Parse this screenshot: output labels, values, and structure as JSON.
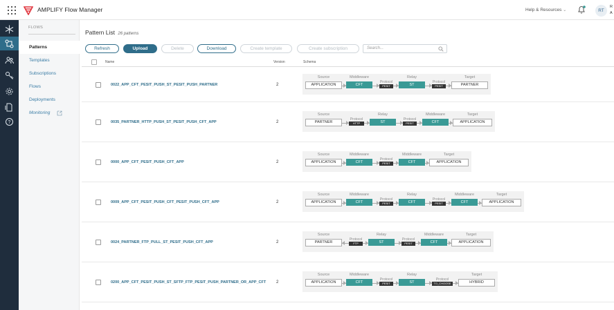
{
  "header": {
    "app_title": "AMPLIFY Flow Manager",
    "help_label": "Help & Resources",
    "avatar_initials": "RT",
    "user_initial_top": "R",
    "user_initial_bottom": "A",
    "brand_color": "#e0343c"
  },
  "rail": {
    "icons": [
      "snowflake-icon",
      "patterns-icon",
      "people-icon",
      "key-icon",
      "gear-icon",
      "document-icon",
      "help-icon"
    ],
    "active_color": "#2f6d8a"
  },
  "subnav": {
    "section": "FLOWS",
    "items": [
      {
        "label": "Patterns",
        "selected": true
      },
      {
        "label": "Templates"
      },
      {
        "label": "Subscriptions"
      },
      {
        "label": "Flows"
      },
      {
        "label": "Deployments"
      },
      {
        "label": "Monitoring"
      }
    ]
  },
  "page": {
    "title": "Pattern List",
    "count": "26 patterns"
  },
  "toolbar": {
    "refresh": "Refresh",
    "upload": "Upload",
    "delete": "Delete",
    "download": "Download",
    "create_template": "Create template",
    "create_subscription": "Create subscription",
    "search_placeholder": "Search..."
  },
  "table": {
    "columns": [
      "Name",
      "Version",
      "Schema"
    ],
    "rows": [
      {
        "name": "0022_APP_CFT_PESIT_PUSH_ST_PESIT_PUSH_PARTNER",
        "version": "2",
        "schema": {
          "source": {
            "label": "Source",
            "value": "APPLICATION"
          },
          "links": [
            {
              "proto_label": "Protocol",
              "proto": "PESIT",
              "node_label": "Middleware",
              "node": "CFT",
              "pre_label": "Middleware",
              "pre": "CFT"
            }
          ]
        }
      }
    ],
    "schemas": [
      {
        "name": "0022_APP_CFT_PESIT_PUSH_ST_PESIT_PUSH_PARTNER",
        "version": "2",
        "source": "APPLICATION",
        "middleware": "CFT",
        "protocol_1": "PESIT",
        "relay": "ST",
        "protocol_2": "PESIT",
        "target": "PARTNER"
      },
      {
        "name": "0035_PARTNER_HTTP_PUSH_ST_PESIT_PUSH_CFT_APP",
        "version": "2",
        "source": "PARTNER",
        "protocol_1": "HTTP",
        "relay": "ST",
        "protocol_2": "PESIT",
        "middleware": "CFT",
        "target": "APPLICATION"
      },
      {
        "name": "0000_APP_CFT_PESIT_PUSH_CFT_APP",
        "version": "2",
        "source": "APPLICATION",
        "middleware": "CFT",
        "protocol_1": "PESIT",
        "middleware_2": "CFT",
        "target": "APPLICATION"
      },
      {
        "name": "0009_APP_CFT_PESIT_PUSH_CFT_PESIT_PUSH_CFT_APP",
        "version": "2",
        "source": "APPLICATION",
        "middleware": "CFT",
        "protocol_1": "PESIT",
        "relay": "CFT",
        "protocol_2": "PESIT",
        "middleware_2": "CFT",
        "target": "APPLICATION"
      },
      {
        "name": "0024_PARTNER_FTP_PULL_ST_PESIT_PUSH_CFT_APP",
        "version": "2",
        "source": "PARTNER",
        "protocol_1": "FTP",
        "relay": "ST",
        "protocol_2": "PESIT",
        "middleware": "CFT",
        "target": "APPLICATION"
      },
      {
        "name": "0200_APP_CFT_PESIT_PUSH_ST_SFTP_FTP_PESIT_PUSH_PARTNER_OR_APP_CFT",
        "version": "2",
        "source": "APPLICATION",
        "middleware": "CFT",
        "protocol_1": "PESIT",
        "relay": "ST",
        "protocol_2": "TO_CHOOSE",
        "target": "HYBRID"
      }
    ],
    "labels": {
      "source": "Source",
      "middleware": "Middleware",
      "protocol": "Protocol",
      "relay": "Relay",
      "target": "Target"
    }
  },
  "colors": {
    "teal": "#3a9a96",
    "link": "#2f6d8a"
  }
}
